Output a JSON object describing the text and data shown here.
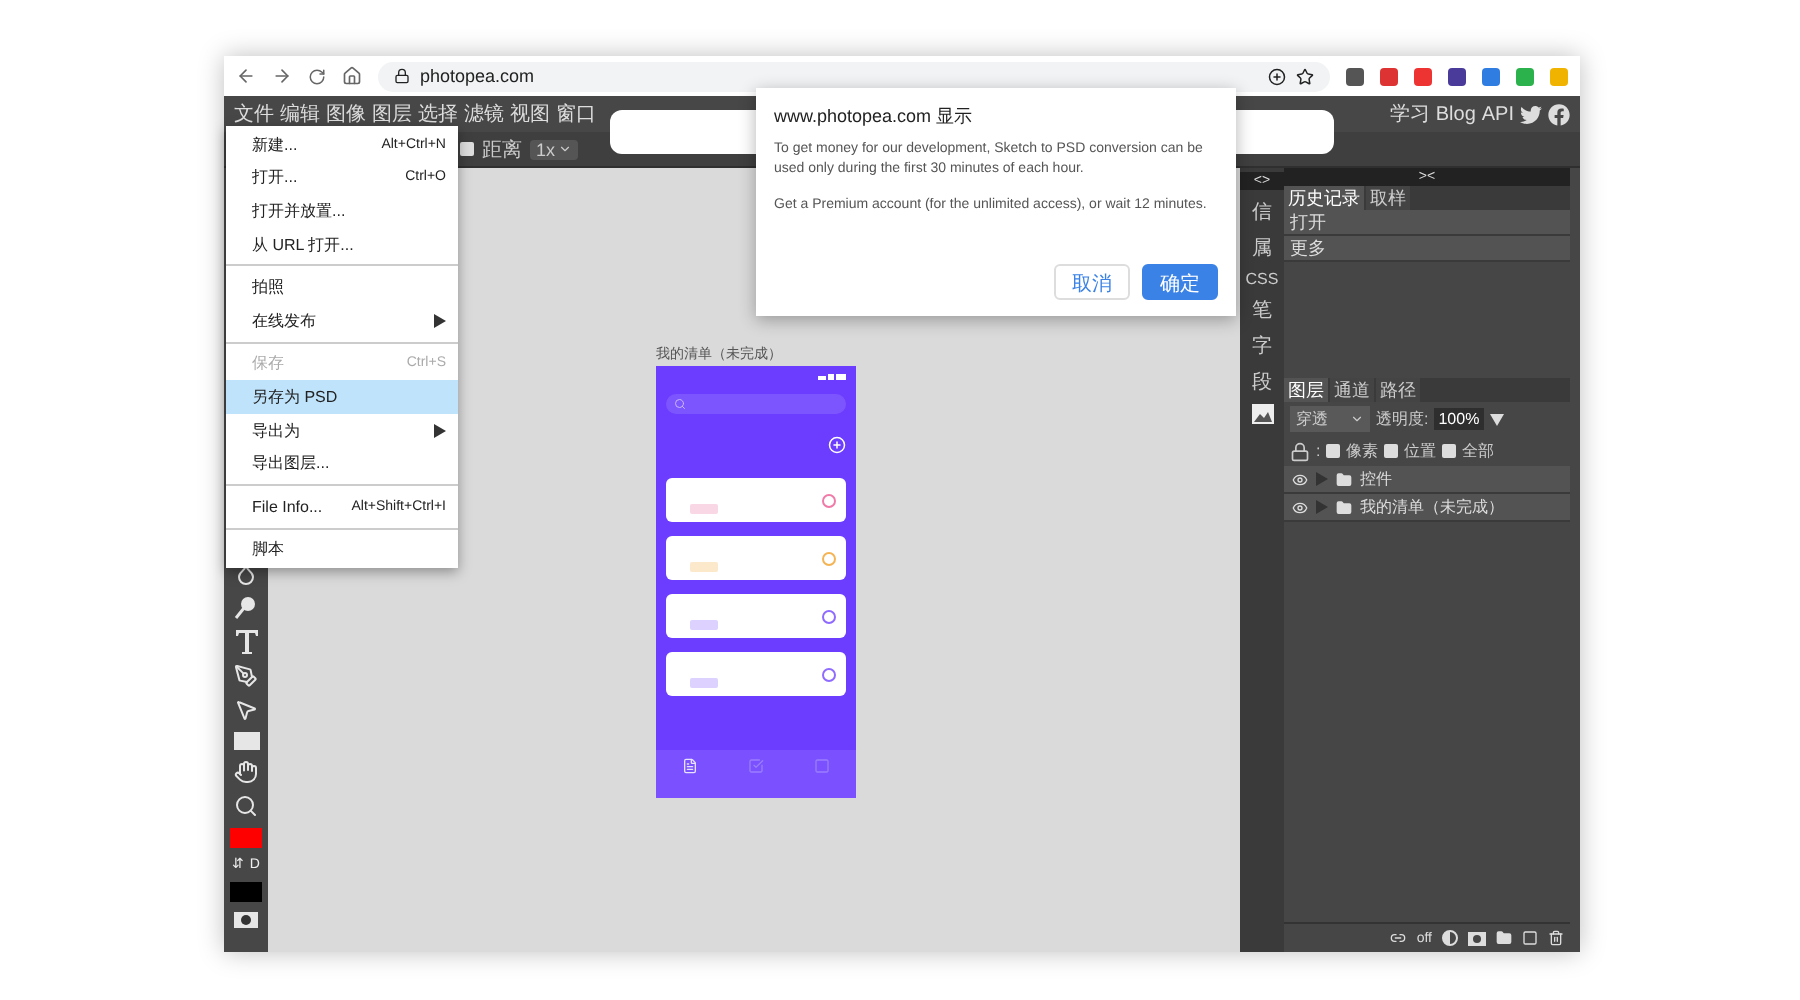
{
  "browser": {
    "url": "photopea.com"
  },
  "menubar": {
    "items": [
      "文件",
      "编辑",
      "图像",
      "图层",
      "选择",
      "滤镜",
      "视图",
      "窗口"
    ],
    "links": [
      "学习",
      "Blog",
      "API"
    ]
  },
  "options_bar": {
    "distance": {
      "label": "距离",
      "checked": false
    },
    "zoom": "1x"
  },
  "file_menu": [
    [
      {
        "label": "新建...",
        "shortcut": "Alt+Ctrl+N",
        "disabled": false,
        "selected": false,
        "submenu": false
      },
      {
        "label": "打开...",
        "shortcut": "Ctrl+O",
        "disabled": false,
        "selected": false,
        "submenu": false
      },
      {
        "label": "打开并放置...",
        "disabled": false,
        "selected": false,
        "submenu": false
      },
      {
        "label": "从 URL 打开...",
        "disabled": false,
        "selected": false,
        "submenu": false
      }
    ],
    [
      {
        "label": "拍照",
        "disabled": false,
        "selected": false,
        "submenu": false
      },
      {
        "label": "在线发布",
        "disabled": false,
        "selected": false,
        "submenu": true
      }
    ],
    [
      {
        "label": "保存",
        "shortcut": "Ctrl+S",
        "disabled": true,
        "selected": false,
        "submenu": false
      },
      {
        "label": "另存为 PSD",
        "disabled": false,
        "selected": true,
        "submenu": false
      },
      {
        "label": "导出为",
        "disabled": false,
        "selected": false,
        "submenu": true
      },
      {
        "label": "导出图层...",
        "disabled": false,
        "selected": false,
        "submenu": false
      }
    ],
    [
      {
        "label": "File Info...",
        "shortcut": "Alt+Shift+Ctrl+I",
        "disabled": false,
        "selected": false,
        "submenu": false
      }
    ],
    [
      {
        "label": "脚本",
        "disabled": false,
        "selected": false,
        "submenu": false
      }
    ]
  ],
  "dialog": {
    "title": "www.photopea.com 显示",
    "paragraphs": [
      "To get money for our development, Sketch to PSD conversion can be used only during the first 30 minutes of each hour.",
      "Get a Premium account (for the unlimited access), or wait 12 minutes."
    ],
    "buttons": [
      {
        "label": "取消",
        "kind": "secondary"
      },
      {
        "label": "确定",
        "kind": "primary"
      }
    ]
  },
  "tool_colors": {
    "swap": "⇵",
    "default": "D"
  },
  "document": {
    "title": "我的清单（未完成）",
    "cards": [
      {
        "color": "#f07aa8"
      },
      {
        "color": "#f5b454"
      },
      {
        "color": "#8f6bff"
      },
      {
        "color": "#8f6bff"
      }
    ]
  },
  "side_tabs": [
    "信",
    "属",
    "CSS",
    "笔",
    "字",
    "段"
  ],
  "panel_toggles": {
    "left": "<>",
    "right": "><"
  },
  "history": {
    "tabs": [
      {
        "label": "历史记录",
        "selected": true
      },
      {
        "label": "取样",
        "selected": false
      }
    ],
    "items": [
      "打开",
      "更多"
    ]
  },
  "layers": {
    "tabs": [
      {
        "label": "图层",
        "selected": true
      },
      {
        "label": "通道",
        "selected": false
      },
      {
        "label": "路径",
        "selected": false
      }
    ],
    "blend_mode": "穿透",
    "opacity_label": "透明度:",
    "opacity": "100%",
    "lock_label": ":",
    "locks": [
      {
        "label": "像素",
        "checked": false
      },
      {
        "label": "位置",
        "checked": false
      },
      {
        "label": "全部",
        "checked": false
      }
    ],
    "items": [
      {
        "name": "控件",
        "visible": true,
        "kind": "folder"
      },
      {
        "name": "我的清单（未完成）",
        "visible": true,
        "kind": "folder"
      }
    ],
    "footer_off": "off"
  }
}
